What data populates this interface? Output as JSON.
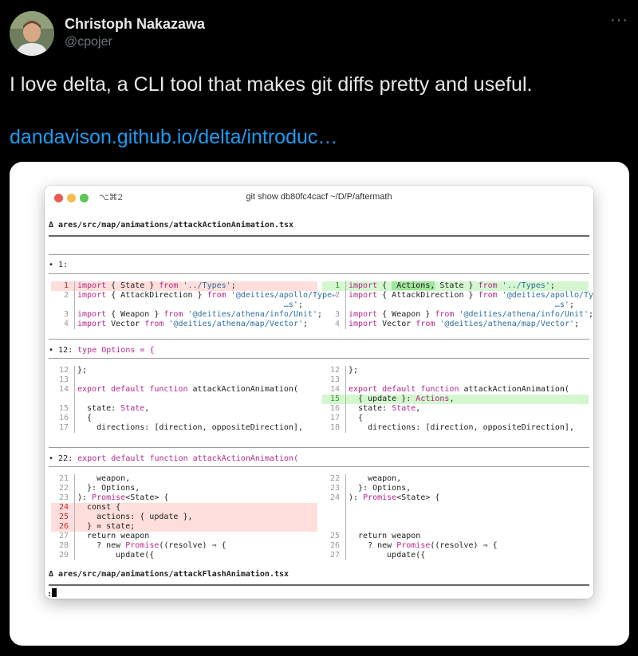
{
  "tweet": {
    "author_name": "Christoph Nakazawa",
    "author_handle": "@cpojer",
    "more_icon": "···",
    "text": "I love delta, a CLI tool that makes git diffs pretty and useful.",
    "link_text": "dandavison.github.io/delta/introduc…"
  },
  "terminal": {
    "shortcut": "⌥⌘2",
    "title": "git show db80fc4cacf ~/D/P/aftermath",
    "file_header_1": "Δ ares/src/map/animations/attackActionAnimation.tsx",
    "file_header_2": "Δ ares/src/map/animations/attackFlashAnimation.tsx",
    "prompt": ":",
    "hunks": [
      {
        "num": "1:",
        "code": "",
        "left": [
          {
            "n": "1",
            "k": "del",
            "t": [
              [
                "import",
                "kw"
              ],
              [
                " { State } ",
                ""
              ],
              [
                "from",
                "kw"
              ],
              [
                " '../Types'",
                "str"
              ],
              [
                ";",
                ""
              ]
            ]
          },
          {
            "n": "2",
            "k": "",
            "t": [
              [
                "import",
                "kw"
              ],
              [
                " { AttackDirection } ",
                ""
              ],
              [
                "from",
                "kw"
              ],
              [
                " '@deities/apollo/Type⤶",
                "str"
              ]
            ]
          },
          {
            "n": "",
            "k": "",
            "t": [
              [
                "                                           …s'",
                "str"
              ],
              [
                ";",
                ""
              ]
            ]
          },
          {
            "n": "3",
            "k": "",
            "t": [
              [
                "import",
                "kw"
              ],
              [
                " { Weapon } ",
                ""
              ],
              [
                "from",
                "kw"
              ],
              [
                " '@deities/athena/info/Unit'",
                "str"
              ],
              [
                ";",
                ""
              ]
            ]
          },
          {
            "n": "4",
            "k": "",
            "t": [
              [
                "import",
                "kw"
              ],
              [
                " Vector ",
                ""
              ],
              [
                "from",
                "kw"
              ],
              [
                " '@deities/athena/map/Vector'",
                "str"
              ],
              [
                ";",
                ""
              ]
            ]
          }
        ],
        "right": [
          {
            "n": "1",
            "k": "add",
            "t": [
              [
                "import",
                "kw"
              ],
              [
                " { ",
                ""
              ],
              [
                " Actions,",
                "hl"
              ],
              [
                " State } ",
                ""
              ],
              [
                "from",
                "kw"
              ],
              [
                " '../Types'",
                "str"
              ],
              [
                ";",
                ""
              ]
            ]
          },
          {
            "n": "2",
            "k": "",
            "t": [
              [
                "import",
                "kw"
              ],
              [
                " { AttackDirection } ",
                ""
              ],
              [
                "from",
                "kw"
              ],
              [
                " '@deities/apollo/Type⤶",
                "str"
              ]
            ]
          },
          {
            "n": "",
            "k": "",
            "t": [
              [
                "                                           …s'",
                "str"
              ],
              [
                ";",
                ""
              ]
            ]
          },
          {
            "n": "3",
            "k": "",
            "t": [
              [
                "import",
                "kw"
              ],
              [
                " { Weapon } ",
                ""
              ],
              [
                "from",
                "kw"
              ],
              [
                " '@deities/athena/info/Unit'",
                "str"
              ],
              [
                ";",
                ""
              ]
            ]
          },
          {
            "n": "4",
            "k": "",
            "t": [
              [
                "import",
                "kw"
              ],
              [
                " Vector ",
                ""
              ],
              [
                "from",
                "kw"
              ],
              [
                " '@deities/athena/map/Vector'",
                "str"
              ],
              [
                ";",
                ""
              ]
            ]
          }
        ]
      },
      {
        "num": "12:",
        "code": "type Options = {",
        "left": [
          {
            "n": "12",
            "k": "",
            "t": [
              [
                "};",
                ""
              ]
            ]
          },
          {
            "n": "13",
            "k": "",
            "t": []
          },
          {
            "n": "14",
            "k": "",
            "t": [
              [
                "export default ",
                "kw"
              ],
              [
                "function",
                "kw"
              ],
              [
                " attackActionAnimation(",
                ""
              ]
            ]
          },
          {
            "n": "",
            "k": "",
            "t": []
          },
          {
            "n": "15",
            "k": "",
            "t": [
              [
                "  state: ",
                ""
              ],
              [
                "State",
                "ty"
              ],
              [
                ",",
                ""
              ]
            ]
          },
          {
            "n": "16",
            "k": "",
            "t": [
              [
                "  {",
                ""
              ]
            ]
          },
          {
            "n": "17",
            "k": "",
            "t": [
              [
                "    directions: [direction, oppositeDirection],",
                ""
              ]
            ]
          }
        ],
        "right": [
          {
            "n": "12",
            "k": "",
            "t": [
              [
                "};",
                ""
              ]
            ]
          },
          {
            "n": "13",
            "k": "",
            "t": []
          },
          {
            "n": "14",
            "k": "",
            "t": [
              [
                "export default ",
                "kw"
              ],
              [
                "function",
                "kw"
              ],
              [
                " attackActionAnimation(",
                ""
              ]
            ]
          },
          {
            "n": "15",
            "k": "add",
            "t": [
              [
                "  { update }: ",
                ""
              ],
              [
                "Actions",
                "ty"
              ],
              [
                ",",
                ""
              ]
            ]
          },
          {
            "n": "16",
            "k": "",
            "t": [
              [
                "  state: ",
                ""
              ],
              [
                "State",
                "ty"
              ],
              [
                ",",
                ""
              ]
            ]
          },
          {
            "n": "17",
            "k": "",
            "t": [
              [
                "  {",
                ""
              ]
            ]
          },
          {
            "n": "18",
            "k": "",
            "t": [
              [
                "    directions: [direction, oppositeDirection],",
                ""
              ]
            ]
          }
        ]
      },
      {
        "num": "22:",
        "code": "export default function attackActionAnimation(",
        "left": [
          {
            "n": "21",
            "k": "",
            "t": [
              [
                "    weapon,",
                ""
              ]
            ]
          },
          {
            "n": "22",
            "k": "",
            "t": [
              [
                "  }: Options,",
                ""
              ]
            ]
          },
          {
            "n": "23",
            "k": "",
            "t": [
              [
                "): ",
                ""
              ],
              [
                "Promise",
                "ty"
              ],
              [
                "<State> {",
                ""
              ]
            ]
          },
          {
            "n": "24",
            "k": "del",
            "t": [
              [
                "  const {",
                ""
              ]
            ]
          },
          {
            "n": "25",
            "k": "del",
            "t": [
              [
                "    actions: { update },",
                ""
              ]
            ]
          },
          {
            "n": "26",
            "k": "del",
            "t": [
              [
                "  } = state;",
                ""
              ]
            ]
          },
          {
            "n": "27",
            "k": "",
            "t": [
              [
                "  return weapon",
                ""
              ]
            ]
          },
          {
            "n": "28",
            "k": "",
            "t": [
              [
                "    ? new ",
                ""
              ],
              [
                "Promise",
                "ty"
              ],
              [
                "((resolve) ⇒ {",
                ""
              ]
            ]
          },
          {
            "n": "29",
            "k": "",
            "t": [
              [
                "        update({",
                ""
              ]
            ]
          }
        ],
        "right": [
          {
            "n": "22",
            "k": "",
            "t": [
              [
                "    weapon,",
                ""
              ]
            ]
          },
          {
            "n": "23",
            "k": "",
            "t": [
              [
                "  }: Options,",
                ""
              ]
            ]
          },
          {
            "n": "24",
            "k": "",
            "t": [
              [
                "): ",
                ""
              ],
              [
                "Promise",
                "ty"
              ],
              [
                "<State> {",
                ""
              ]
            ]
          },
          {
            "n": "",
            "k": "",
            "t": []
          },
          {
            "n": "",
            "k": "",
            "t": []
          },
          {
            "n": "",
            "k": "",
            "t": []
          },
          {
            "n": "25",
            "k": "",
            "t": [
              [
                "  return weapon",
                ""
              ]
            ]
          },
          {
            "n": "26",
            "k": "",
            "t": [
              [
                "    ? new ",
                ""
              ],
              [
                "Promise",
                "ty"
              ],
              [
                "((resolve) ⇒ {",
                ""
              ]
            ]
          },
          {
            "n": "27",
            "k": "",
            "t": [
              [
                "        update({",
                ""
              ]
            ]
          }
        ]
      }
    ]
  }
}
